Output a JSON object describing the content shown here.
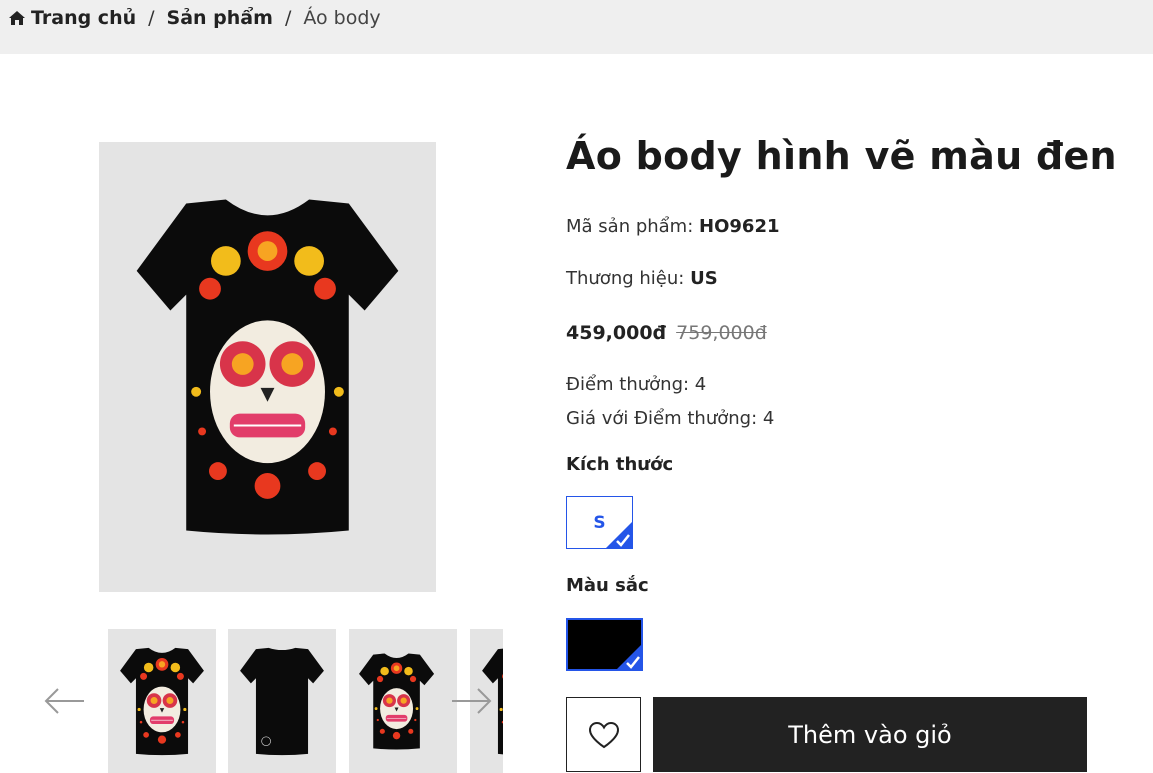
{
  "breadcrumb": {
    "home": "Trang chủ",
    "category": "Sản phẩm",
    "current": "Áo body",
    "separator": "/",
    "home_icon": "home-icon"
  },
  "product": {
    "title": "Áo body hình vẽ màu đen",
    "sku_label": "Mã sản phẩm:",
    "sku": "HO9621",
    "brand_label": "Thương hiệu:",
    "brand": "US",
    "price": "459,000đ",
    "old_price": "759,000đ",
    "points_label": "Điểm thưởng: 4",
    "points_price_label": "Giá với Điểm thưởng: 4"
  },
  "options": {
    "size_label": "Kích thước",
    "sizes": [
      "S"
    ],
    "selected_size": "S",
    "color_label": "Màu sắc",
    "selected_color": "#000000"
  },
  "actions": {
    "add_to_cart": "Thêm vào giỏ",
    "wishlist_icon": "heart-icon"
  },
  "gallery": {
    "prev_icon": "arrow-left-icon",
    "next_icon": "arrow-right-icon",
    "thumbnails": [
      "front",
      "back",
      "side",
      "partial"
    ]
  },
  "colors": {
    "accent": "#2455e8",
    "button_bg": "#222222",
    "breadcrumb_bg": "#efefef",
    "image_bg": "#e4e4e4"
  }
}
